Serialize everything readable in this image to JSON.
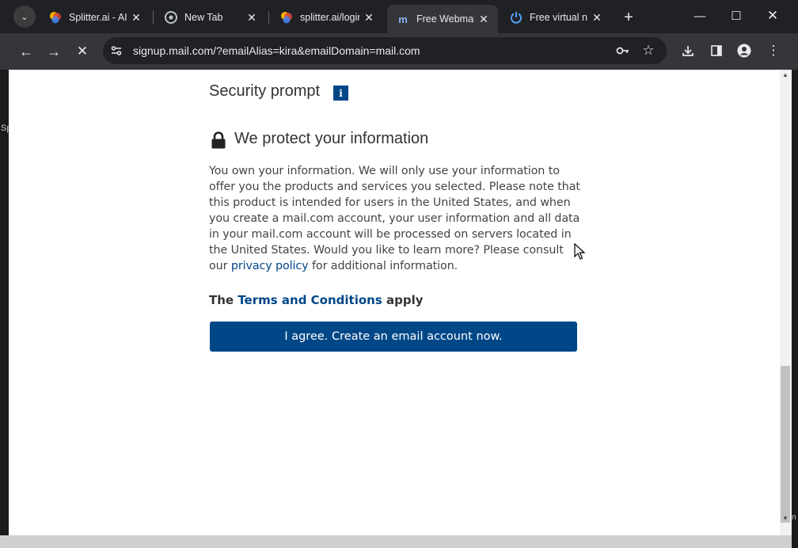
{
  "browser": {
    "tabs": [
      {
        "title": "Splitter.ai - AI",
        "favicon": "splitter-icon",
        "active": false
      },
      {
        "title": "New Tab",
        "favicon": "chrome-icon",
        "active": false
      },
      {
        "title": "splitter.ai/login",
        "favicon": "splitter-icon",
        "active": false
      },
      {
        "title": "Free Webmail",
        "favicon": "mailcom-icon",
        "active": true
      },
      {
        "title": "Free virtual num",
        "favicon": "power-icon",
        "active": false
      }
    ],
    "url": "signup.mail.com/?emailAlias=kira&emailDomain=mail.com"
  },
  "page": {
    "security_prompt": "Security prompt",
    "info_badge": "i",
    "protect_title": "We protect your information",
    "paragraph_before_link": "You own your information. We will only use your information to offer you the products and services you selected. Please note that this product is intended for users in the United States, and when you create a mail.com account, your user information and all data in your mail.com account will be processed on servers located in the United States. Would you like to learn more? Please consult our ",
    "privacy_link": "privacy policy",
    "paragraph_after_link": " for additional information.",
    "terms_prefix": "The ",
    "terms_link": "Terms and Conditions",
    "terms_suffix": " apply",
    "agree_button": "I agree. Create an email account now."
  },
  "edge_text": {
    "left": "Sp",
    "right": "n"
  },
  "colors": {
    "brand": "#004788",
    "chrome_dark": "#202124",
    "toolbar": "#35363a"
  }
}
